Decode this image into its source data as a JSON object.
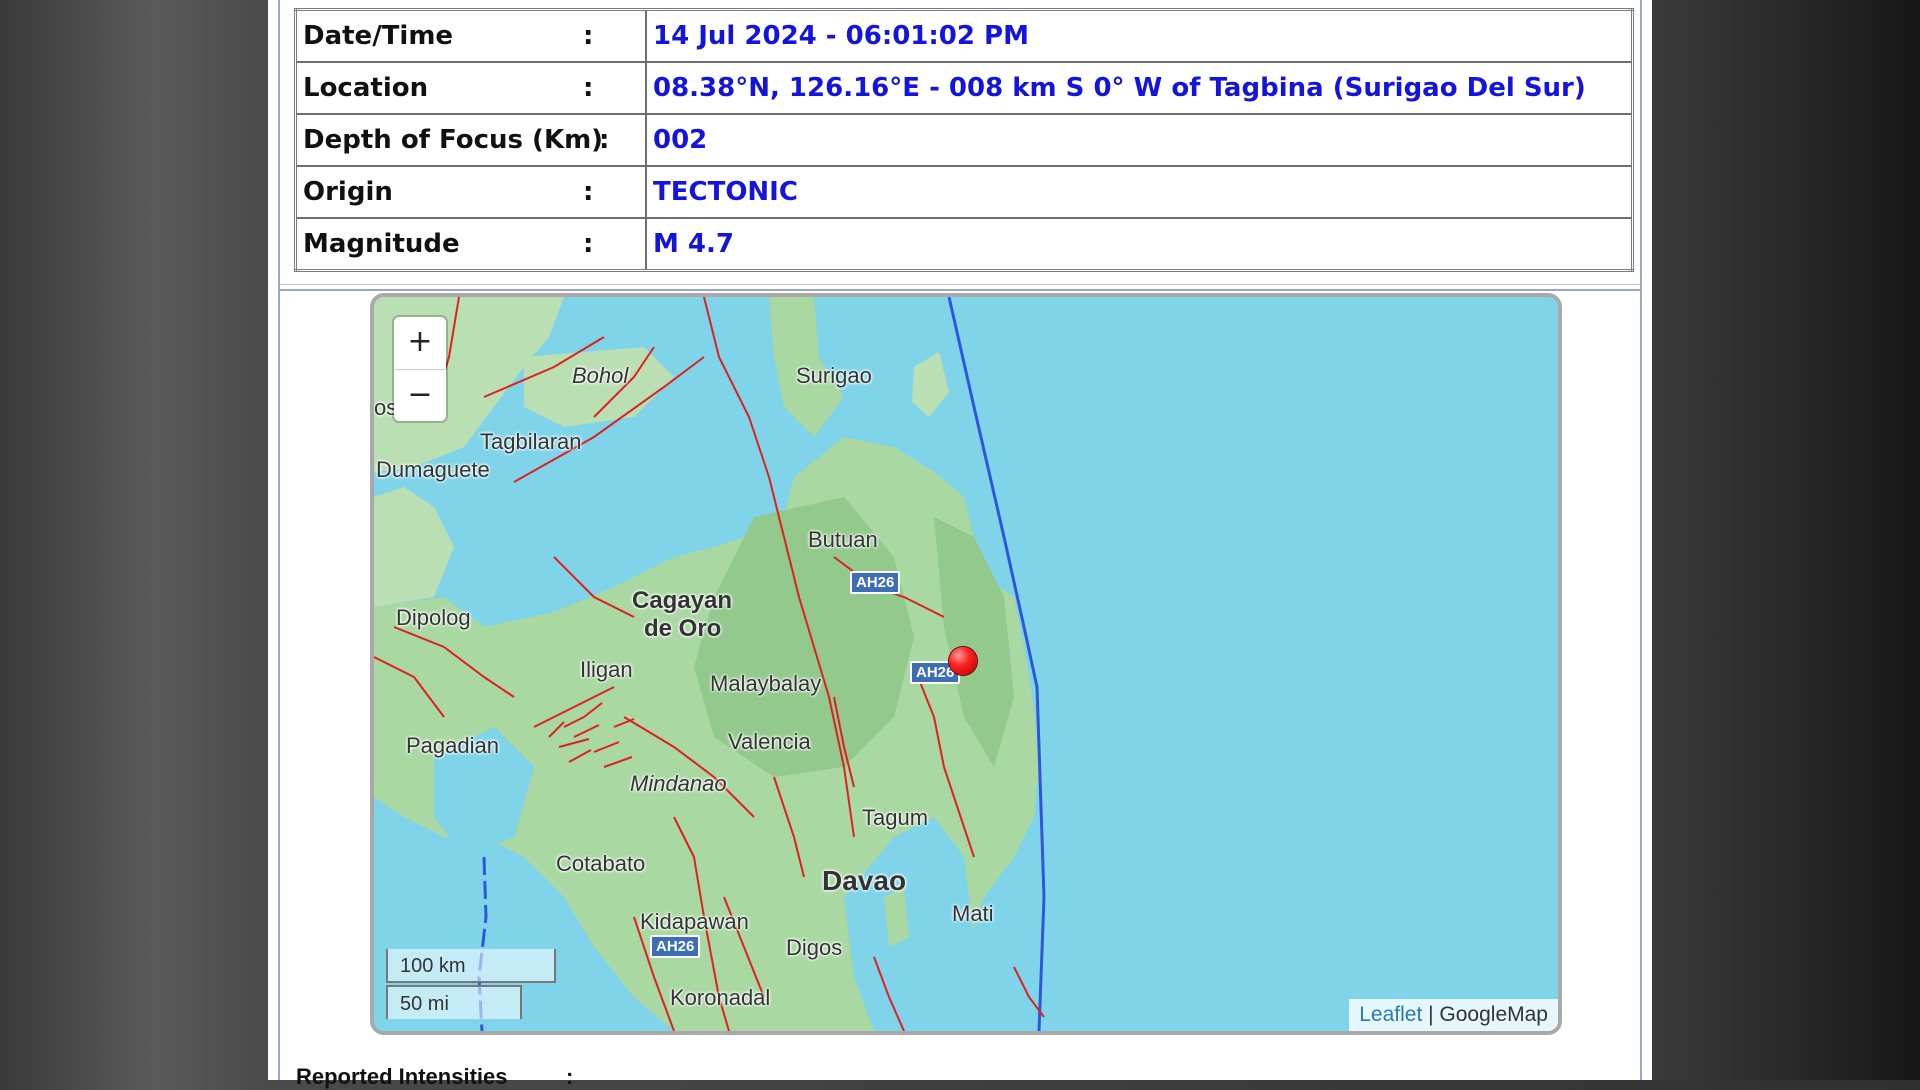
{
  "info": {
    "rows": [
      {
        "label": "Date/Time",
        "sep": ":",
        "value": "14 Jul 2024 - 06:01:02 PM"
      },
      {
        "label": "Location",
        "sep": ":",
        "value": "08.38°N, 126.16°E - 008 km S 0° W of Tagbina (Surigao Del Sur)"
      },
      {
        "label": "Depth of Focus (Km)",
        "sep": ":",
        "value": "002"
      },
      {
        "label": "Origin",
        "sep": ":",
        "value": "TECTONIC"
      },
      {
        "label": "Magnitude",
        "sep": ":",
        "value": "M 4.7"
      }
    ]
  },
  "map": {
    "zoom_in": "+",
    "zoom_out": "−",
    "places": {
      "bohol": "Bohol",
      "surigao": "Surigao",
      "tagbilaran": "Tagbilaran",
      "dumaguete": "Dumaguete",
      "os": "os",
      "butuan": "Butuan",
      "cagayan": "Cagayan",
      "deoro": "de Oro",
      "dipolog": "Dipolog",
      "iligan": "Iligan",
      "malaybalay": "Malaybalay",
      "pagadian": "Pagadian",
      "valencia": "Valencia",
      "mindanao": "Mindanao",
      "tagum": "Tagum",
      "cotabato": "Cotabato",
      "davao": "Davao",
      "mati": "Mati",
      "kidapawan": "Kidapawan",
      "digos": "Digos",
      "koronadal": "Koronadal"
    },
    "shields": {
      "a": "AH26",
      "b": "AH26",
      "c": "AH26"
    },
    "scale": {
      "km": "100 km",
      "mi": "50 mi"
    },
    "attribution": {
      "leaflet": "Leaflet",
      "sep": " | ",
      "provider": "GoogleMap"
    },
    "epicenter_color": "#ff2020"
  },
  "footer": {
    "reported_label": "Reported Intensities",
    "reported_sep": ":"
  }
}
